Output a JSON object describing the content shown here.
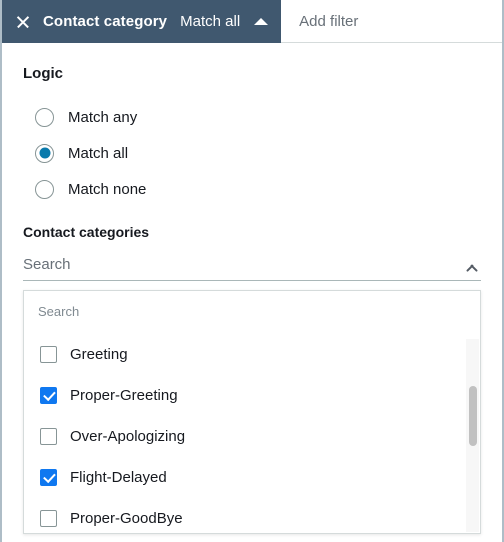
{
  "filter_bar": {
    "token": {
      "close_icon": "close-icon",
      "property_label": "Contact category",
      "operator_label": "Match all",
      "caret_icon": "caret-up-icon"
    },
    "add_filter_placeholder": "Add filter",
    "add_filter_value": ""
  },
  "logic": {
    "label": "Logic",
    "selected": "Match all",
    "options": [
      {
        "label": "Match any",
        "checked": false
      },
      {
        "label": "Match all",
        "checked": true
      },
      {
        "label": "Match none",
        "checked": false
      }
    ]
  },
  "contact_categories": {
    "label": "Contact categories",
    "select_placeholder": "Search",
    "select_value": "Search",
    "chevron_icon": "chevron-up-icon",
    "dropdown": {
      "search_placeholder": "Search",
      "search_value": "",
      "options": [
        {
          "label": "Greeting",
          "checked": false
        },
        {
          "label": "Proper-Greeting",
          "checked": true
        },
        {
          "label": "Over-Apologizing",
          "checked": false
        },
        {
          "label": "Flight-Delayed",
          "checked": true
        },
        {
          "label": "Proper-GoodBye",
          "checked": false
        }
      ]
    }
  },
  "colors": {
    "token_background": "#40586f",
    "radio_selected": "#0a7aac",
    "checkbox_checked": "#0f78f0",
    "frame_border": "#aebdc7",
    "text_primary": "#16191f",
    "text_secondary": "#687078"
  }
}
